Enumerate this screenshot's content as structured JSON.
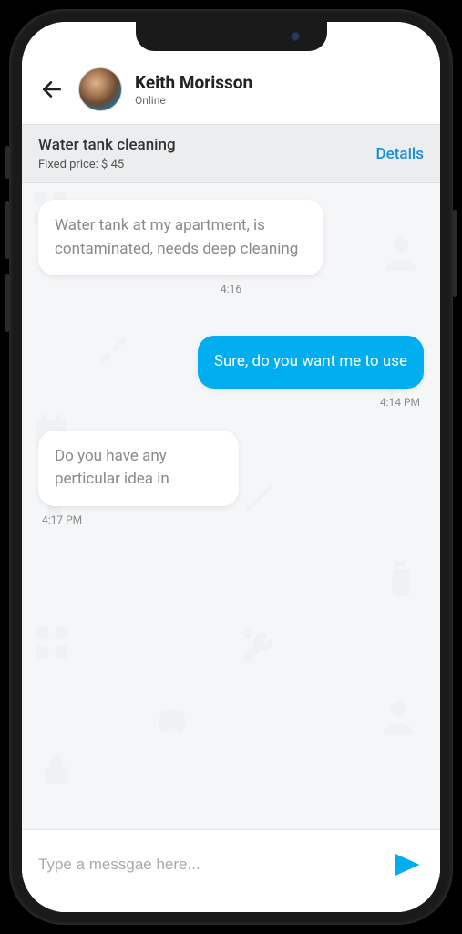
{
  "header": {
    "contact_name": "Keith Morisson",
    "status": "Online"
  },
  "jobbar": {
    "title": "Water tank cleaning",
    "price_label": "Fixed price: $ 45",
    "details_label": "Details"
  },
  "messages": [
    {
      "side": "left",
      "text": "Water tank at my apartment, is contaminated, needs deep cleaning",
      "time": "4:16"
    },
    {
      "side": "right",
      "text": "Sure, do you want me to use",
      "time": "4:14 PM"
    },
    {
      "side": "left",
      "text": "Do you have any perticular idea in",
      "time": "4:17 PM"
    }
  ],
  "composer": {
    "placeholder": "Type a messgae here..."
  },
  "colors": {
    "accent": "#00aeef",
    "link": "#1b8fd6"
  }
}
